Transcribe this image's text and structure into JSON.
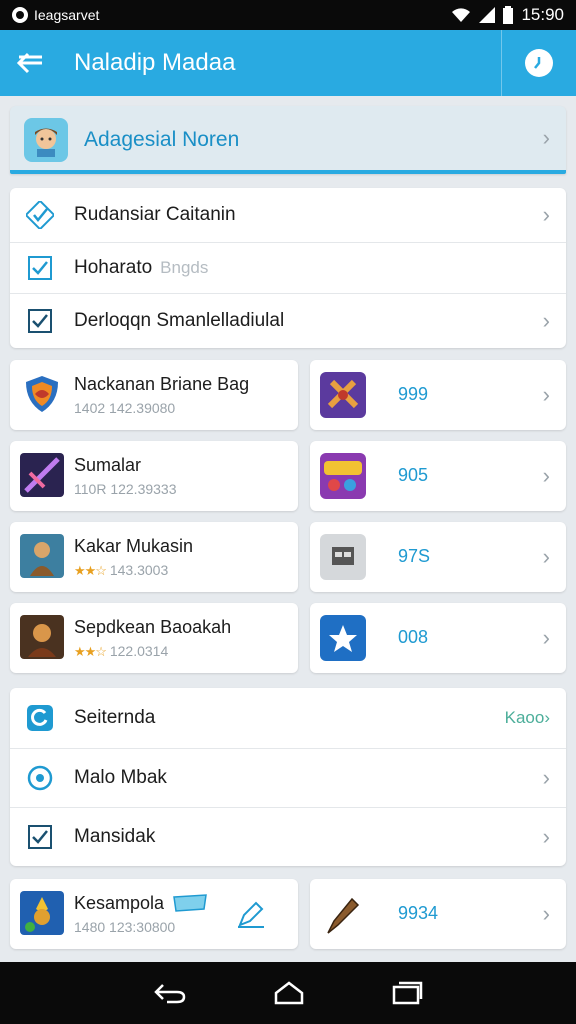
{
  "status_bar": {
    "carrier": "Ieagsarvet",
    "time": "15:90"
  },
  "app_bar": {
    "title": "Naladip Madaa"
  },
  "profile": {
    "name": "Adagesial Noren"
  },
  "checklist": [
    {
      "label": "Rudansiar Caitanin",
      "sub": ""
    },
    {
      "label": "Hoharato",
      "sub": "Bngds"
    },
    {
      "label": "Derloqqn Smanlelladiulal",
      "sub": ""
    }
  ],
  "apps": [
    {
      "title": "Nackanan Briane Bag",
      "meta": "1402  142.39080"
    },
    {
      "title": "Sumalar",
      "meta": "110R  122.39333"
    },
    {
      "title": "Kakar Mukasin",
      "meta": "143.3003",
      "stars": "★★☆"
    },
    {
      "title": "Sepdkean Baoakah",
      "meta": "122.0314",
      "stars": "★★☆"
    }
  ],
  "side_values": [
    "999",
    "905",
    "97S",
    "008"
  ],
  "settings": [
    {
      "label": "Seiternda",
      "link": "Kaoo"
    },
    {
      "label": "Malo Mbak",
      "link": ""
    },
    {
      "label": "Mansidak",
      "link": ""
    }
  ],
  "bottom_app": {
    "title": "Kesampola",
    "meta": "1480  123:30800"
  },
  "bottom_side_value": "9934",
  "colors": {
    "accent": "#29aae1",
    "link": "#4cae9a",
    "star": "#e8a020"
  }
}
